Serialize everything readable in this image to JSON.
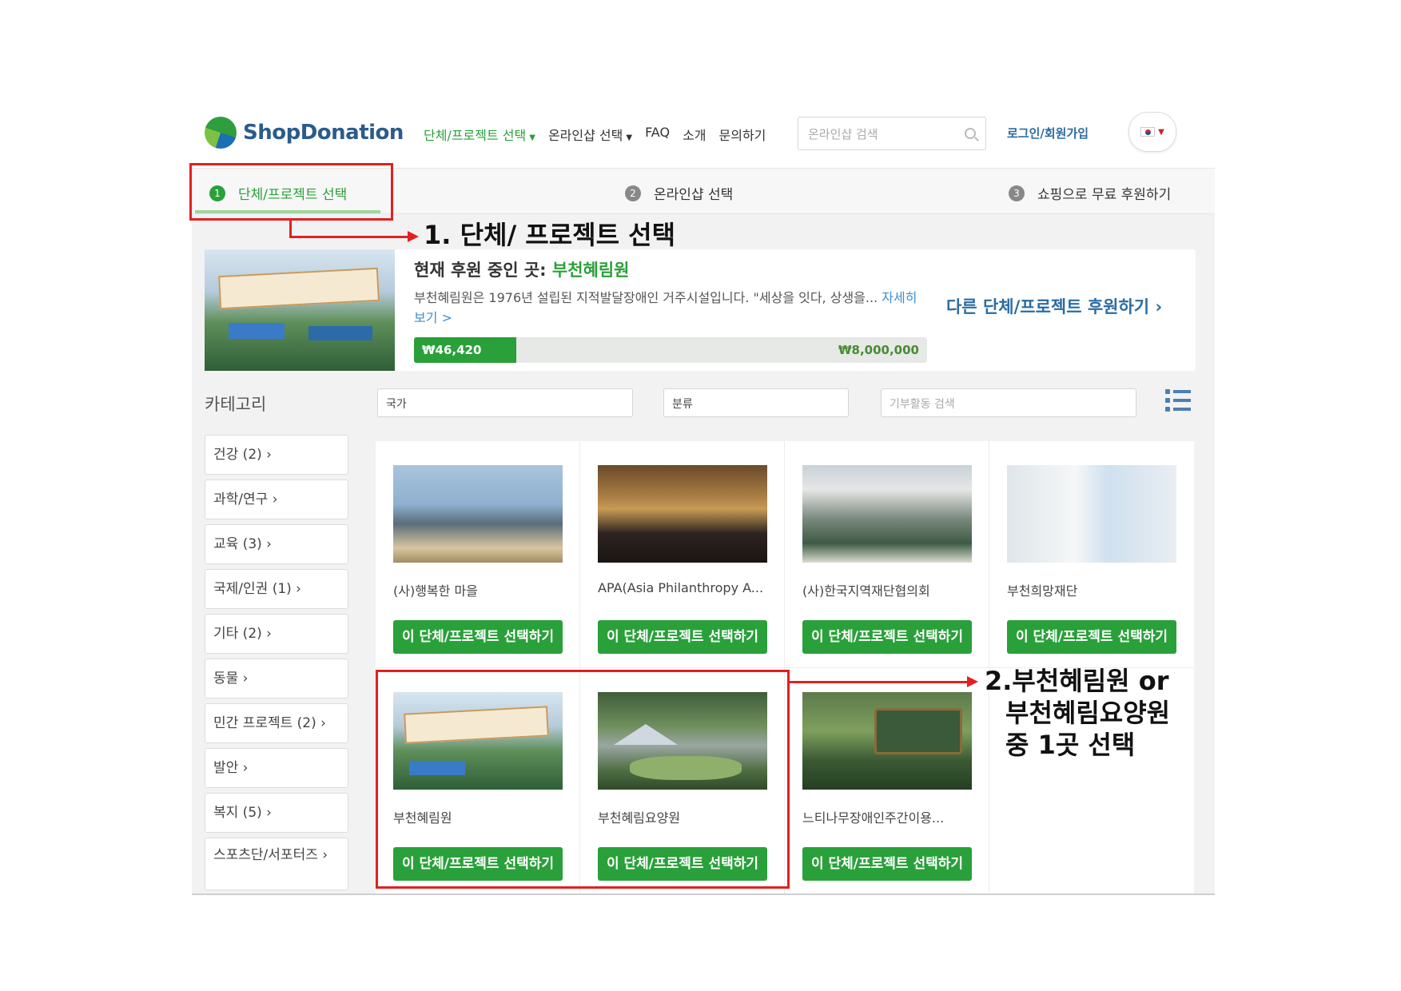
{
  "header": {
    "logo_text": "ShopDonation",
    "nav": [
      {
        "label": "단체/프로젝트 선택",
        "has_caret": true,
        "active": true
      },
      {
        "label": "온라인샵 선택",
        "has_caret": true,
        "active": false
      },
      {
        "label": "FAQ",
        "has_caret": false,
        "active": false
      },
      {
        "label": "소개",
        "has_caret": false,
        "active": false
      },
      {
        "label": "문의하기",
        "has_caret": false,
        "active": false
      }
    ],
    "search_placeholder": "온라인샵 검색",
    "login_label": "로그인/회원가입",
    "language_flag": "south-korea-flag-icon"
  },
  "steps": [
    {
      "number": "1",
      "label": "단체/프로젝트 선택",
      "active": true
    },
    {
      "number": "2",
      "label": "온라인샵 선택",
      "active": false
    },
    {
      "number": "3",
      "label": "쇼핑으로 무료 후원하기",
      "active": false
    }
  ],
  "banner": {
    "title_prefix": "현재 후원 중인 곳:",
    "title_org": "부천혜림원",
    "description": "부천혜림원은 1976년 설립된 지적발달장애인 거주시설입니다. \"세상을 잇다, 상생을...",
    "more_link": "자세히 보기 >",
    "current_amount": "₩46,420",
    "goal_amount": "₩8,000,000",
    "progress_fraction": 0.2,
    "other_link": "다른 단체/프로젝트 후원하기 ›"
  },
  "filters": {
    "category_title": "카테고리",
    "country_placeholder": "국가",
    "type_placeholder": "분류",
    "search_placeholder": "기부활동 검색"
  },
  "categories": [
    "건강 (2) ›",
    "과학/연구 ›",
    "교육 (3) ›",
    "국제/인권 (1) ›",
    "기타 (2) ›",
    "동물 ›",
    "민간 프로젝트 (2) ›",
    "발안 ›",
    "복지 (5) ›",
    "스포츠단/서포터즈 ›"
  ],
  "select_button_label": "이 단체/프로젝트 선택하기",
  "organizations": [
    {
      "name": "(사)행복한 마을"
    },
    {
      "name": "APA(Asia Philanthropy A..."
    },
    {
      "name": "(사)한국지역재단협의회"
    },
    {
      "name": "부천희망재단"
    },
    {
      "name": "부천혜림원"
    },
    {
      "name": "부천혜림요양원"
    },
    {
      "name": "느티나무장애인주간이용..."
    }
  ],
  "annotations": {
    "step1": "1. 단체/ 프로젝트 선택",
    "step2_line1": "2.부천혜림원  or",
    "step2_line2": "부천혜림요양원",
    "step2_line3": "중 1곳 선택",
    "color": "#e32020"
  },
  "colors": {
    "accent_green": "#2aa03a",
    "link_blue": "#2b6ca3"
  }
}
